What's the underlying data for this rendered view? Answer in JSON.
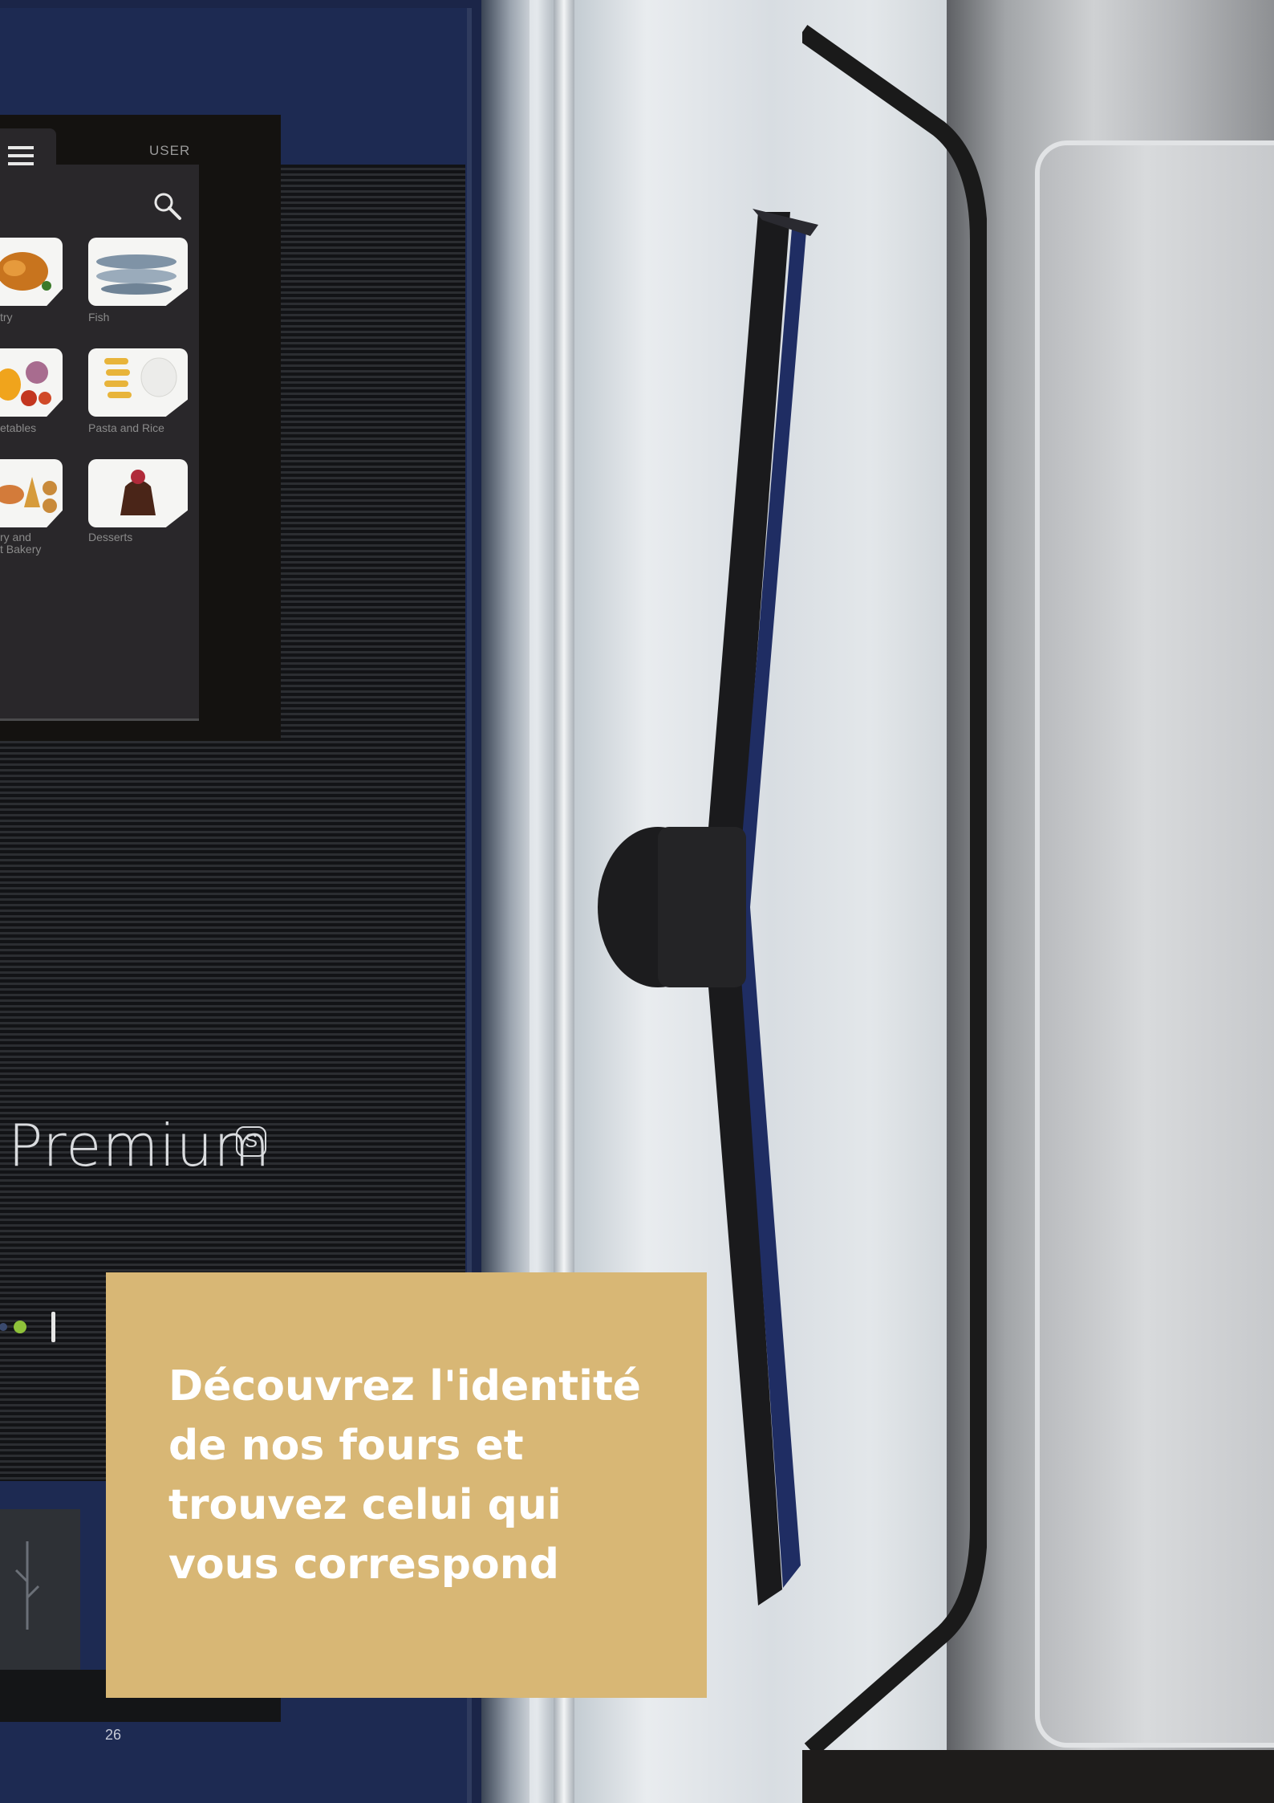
{
  "screen": {
    "user_label": "USER",
    "tiles": [
      {
        "label": "try",
        "icon": "poultry-icon"
      },
      {
        "label": "Fish",
        "icon": "fish-icon"
      },
      {
        "label": "etables",
        "icon": "vegetables-icon"
      },
      {
        "label": "Pasta and Rice",
        "icon": "pasta-icon"
      },
      {
        "label": "ry and\nt Bakery",
        "icon": "bakery-icon"
      },
      {
        "label": "Desserts",
        "icon": "dessert-icon"
      }
    ]
  },
  "brand": {
    "name": "Premium",
    "mark": "S"
  },
  "callout": {
    "text_line1": "Découvrez l'identité",
    "text_line2": "de nos fours et",
    "text_line3": "trouvez celui qui",
    "text_line4": "vous correspond"
  },
  "page_number": "26",
  "colors": {
    "gold": "#d8b775",
    "navy": "#1d2a52",
    "handle_blue": "#1f2d63"
  }
}
